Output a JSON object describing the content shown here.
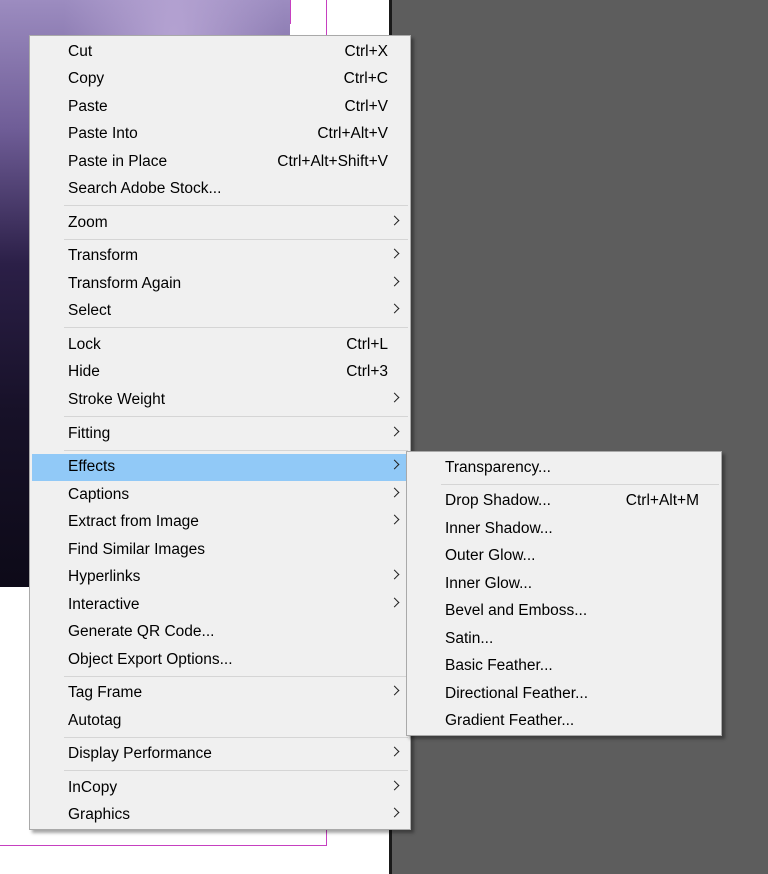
{
  "context_menu": {
    "items": [
      {
        "label": "Cut",
        "shortcut": "Ctrl+X"
      },
      {
        "label": "Copy",
        "shortcut": "Ctrl+C"
      },
      {
        "label": "Paste",
        "shortcut": "Ctrl+V"
      },
      {
        "label": "Paste Into",
        "shortcut": "Ctrl+Alt+V"
      },
      {
        "label": "Paste in Place",
        "shortcut": "Ctrl+Alt+Shift+V"
      },
      {
        "label": "Search Adobe Stock...",
        "shortcut": ""
      },
      {
        "label": "Zoom",
        "shortcut": ""
      },
      {
        "label": "Transform",
        "shortcut": ""
      },
      {
        "label": "Transform Again",
        "shortcut": ""
      },
      {
        "label": "Select",
        "shortcut": ""
      },
      {
        "label": "Lock",
        "shortcut": "Ctrl+L"
      },
      {
        "label": "Hide",
        "shortcut": "Ctrl+3"
      },
      {
        "label": "Stroke Weight",
        "shortcut": ""
      },
      {
        "label": "Fitting",
        "shortcut": ""
      },
      {
        "label": "Effects",
        "shortcut": ""
      },
      {
        "label": "Captions",
        "shortcut": ""
      },
      {
        "label": "Extract from Image",
        "shortcut": ""
      },
      {
        "label": "Find Similar Images",
        "shortcut": ""
      },
      {
        "label": "Hyperlinks",
        "shortcut": ""
      },
      {
        "label": "Interactive",
        "shortcut": ""
      },
      {
        "label": "Generate QR Code...",
        "shortcut": ""
      },
      {
        "label": "Object Export Options...",
        "shortcut": ""
      },
      {
        "label": "Tag Frame",
        "shortcut": ""
      },
      {
        "label": "Autotag",
        "shortcut": ""
      },
      {
        "label": "Display Performance",
        "shortcut": ""
      },
      {
        "label": "InCopy",
        "shortcut": ""
      },
      {
        "label": "Graphics",
        "shortcut": ""
      }
    ],
    "highlighted_item": "Effects",
    "highlight_color": "#91c9f7"
  },
  "effects_submenu": {
    "items": [
      {
        "label": "Transparency...",
        "shortcut": ""
      },
      {
        "label": "Drop Shadow...",
        "shortcut": "Ctrl+Alt+M"
      },
      {
        "label": "Inner Shadow...",
        "shortcut": ""
      },
      {
        "label": "Outer Glow...",
        "shortcut": ""
      },
      {
        "label": "Inner Glow...",
        "shortcut": ""
      },
      {
        "label": "Bevel and Emboss...",
        "shortcut": ""
      },
      {
        "label": "Satin...",
        "shortcut": ""
      },
      {
        "label": "Basic Feather...",
        "shortcut": ""
      },
      {
        "label": "Directional Feather...",
        "shortcut": ""
      },
      {
        "label": "Gradient Feather...",
        "shortcut": ""
      }
    ]
  },
  "colors": {
    "menu_background": "#f0f0f0",
    "pasteboard": "#5d5d5d",
    "frame_edge": "#c640c0"
  }
}
